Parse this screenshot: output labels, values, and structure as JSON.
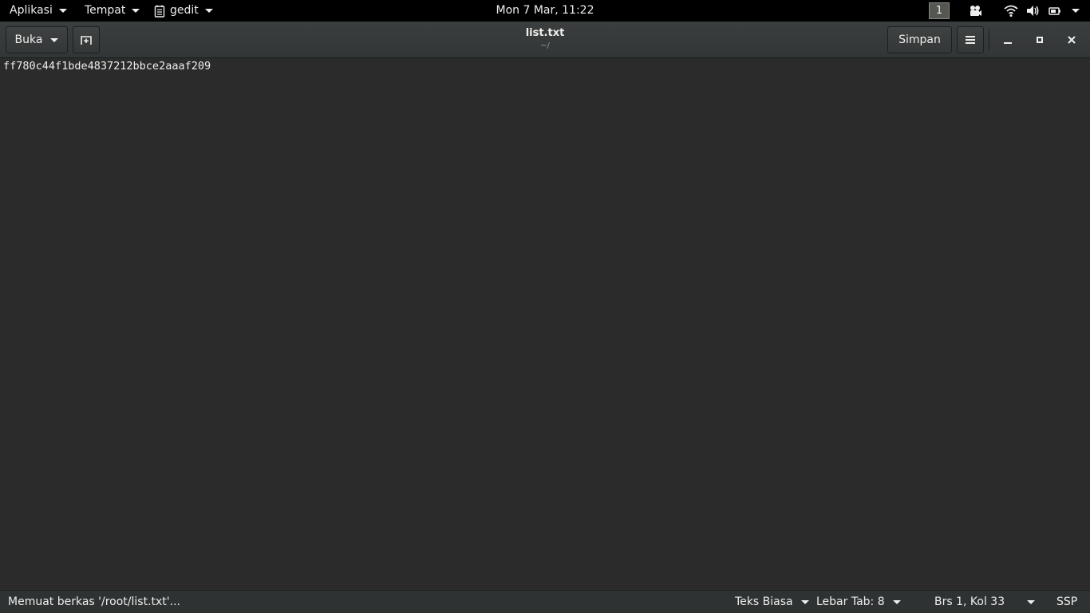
{
  "top_panel": {
    "applications_label": "Aplikasi",
    "places_label": "Tempat",
    "app_menu_label": "gedit",
    "clock": "Mon  7 Mar, 11:22",
    "workspace": "1"
  },
  "header": {
    "open_label": "Buka",
    "title": "list.txt",
    "subtitle": "~/",
    "save_label": "Simpan"
  },
  "editor": {
    "lines": [
      "ff780c44f1bde4837212bbce2aaaf209"
    ]
  },
  "statusbar": {
    "message": "Memuat berkas '/root/list.txt'...",
    "language": "Teks Biasa",
    "tab_width": "Lebar Tab: 8",
    "cursor_position": "Brs 1, Kol 33",
    "insert_mode": "SSP"
  }
}
